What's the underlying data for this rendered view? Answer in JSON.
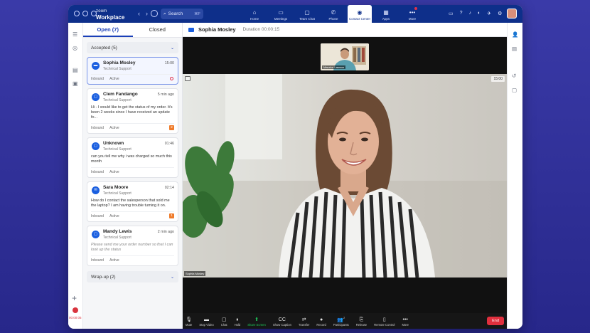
{
  "app": {
    "brand_line1": "zoom",
    "brand_line2": "Workplace",
    "search_label": "Search",
    "search_shortcut": "⌘F"
  },
  "nav": [
    {
      "label": "Home",
      "icon": "home-icon",
      "glyph": "⌂"
    },
    {
      "label": "Meetings",
      "icon": "video-icon",
      "glyph": "▭"
    },
    {
      "label": "Team Chat",
      "icon": "chat-icon",
      "glyph": "▢"
    },
    {
      "label": "Phone",
      "icon": "phone-icon",
      "glyph": "✆"
    },
    {
      "label": "Contact Center",
      "icon": "contact-center-icon",
      "glyph": "◉",
      "active": true
    },
    {
      "label": "Apps",
      "icon": "apps-icon",
      "glyph": "▦"
    },
    {
      "label": "More",
      "icon": "more-icon",
      "glyph": "•••",
      "notify": true
    }
  ],
  "list": {
    "tab_open": "Open (7)",
    "tab_closed": "Closed",
    "group_accepted": "Accepted (5)",
    "group_wrapup": "Wrap-up (2)",
    "items": [
      {
        "name": "Sophia Mosley",
        "sub": "Technical Support",
        "time": "15:00",
        "msg": "",
        "dir": "Inbound",
        "status": "Active",
        "channel": "video"
      },
      {
        "name": "Clem Fandango",
        "sub": "Technical Support",
        "time": "5 min ago",
        "msg": "Hi - I would like to get the status of my order. It's been 2 weeks since I have received an update fo...",
        "dir": "Inbound",
        "status": "Active",
        "badge": "2",
        "channel": "chat"
      },
      {
        "name": "Unknown",
        "sub": "Technical Support",
        "time": "01:46",
        "msg": "can you tell me why i was charged so much this month",
        "dir": "Inbound",
        "status": "Active",
        "channel": "chat"
      },
      {
        "name": "Sara Moore",
        "sub": "Technical Support",
        "time": "02:14",
        "msg": "How do I contact the salesperson that sold me the laptop? I am having trouble turning it on.",
        "dir": "Inbound",
        "status": "Active",
        "badge": "1",
        "channel": "email"
      },
      {
        "name": "Mandy Lewis",
        "sub": "Technical Support",
        "time": "2 min ago",
        "msg": "Please send me your order number so that I can look up the status",
        "dir": "Inbound",
        "status": "Active",
        "channel": "chat"
      }
    ]
  },
  "call": {
    "name": "Sophia Mosley",
    "duration_label": "Duration 00:00:15",
    "self_label": "Maurice Lawson",
    "main_label": "Sophia Mosley",
    "video_time": "15:00"
  },
  "toolbar": [
    {
      "label": "Mute",
      "icon": "microphone-icon",
      "glyph": "🎙"
    },
    {
      "label": "Stop Video",
      "icon": "camera-icon",
      "glyph": "▬"
    },
    {
      "label": "Chat",
      "icon": "chat-bubble-icon",
      "glyph": "▢"
    },
    {
      "label": "Hold",
      "icon": "hold-icon",
      "glyph": "⏸"
    },
    {
      "label": "Share Screen",
      "icon": "share-screen-icon",
      "glyph": "⬆",
      "green": true
    },
    {
      "label": "Show Caption",
      "icon": "caption-icon",
      "glyph": "CC"
    },
    {
      "label": "Transfer",
      "icon": "transfer-icon",
      "glyph": "⇄"
    },
    {
      "label": "Record",
      "icon": "record-icon",
      "glyph": "●"
    },
    {
      "label": "Participants",
      "icon": "participants-icon",
      "glyph": "👥"
    },
    {
      "label": "Release",
      "icon": "release-icon",
      "glyph": "⎘"
    },
    {
      "label": "Remote Control",
      "icon": "remote-control-icon",
      "glyph": "▯"
    },
    {
      "label": "More",
      "icon": "more-dots-icon",
      "glyph": "•••"
    }
  ],
  "end_label": "End",
  "participants_count": "2",
  "rail_timer": "00:00:05",
  "colors": {
    "topbar": "#0e2f8a",
    "accent": "#1a3fb8",
    "end": "#e02f3d",
    "share_green": "#1fc95a",
    "badge": "#ef7b2a"
  }
}
